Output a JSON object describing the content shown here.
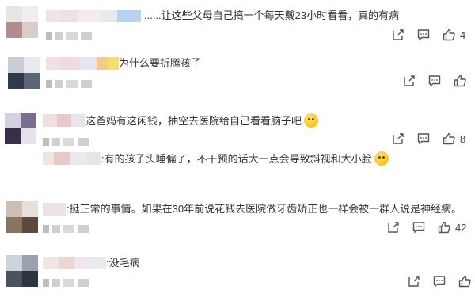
{
  "comments": [
    {
      "text": "......让这些父母自己搞一个每天戴23小时看看，真的有病",
      "like_count": "4",
      "icons": [
        "share-icon",
        "comment-icon",
        "like-icon"
      ]
    },
    {
      "text": "为什么要折腾孩子",
      "like_count": "",
      "icons": [
        "share-icon",
        "comment-icon",
        "like-icon"
      ]
    },
    {
      "text": "这爸妈有这闲钱，抽空去医院给自己看看脑子吧",
      "like_count": "8",
      "icons": [
        "share-icon",
        "comment-icon",
        "like-icon"
      ],
      "reply": {
        "text": ":有的孩子头睡偏了，不干预的话大一点会导致斜视和大小脸"
      }
    },
    {
      "text": ":挺正常的事情。如果在30年前说花钱去医院做牙齿矫正也一样会被一群人说是神经病。",
      "like_count": "42",
      "icons": [
        "share-icon",
        "comment-icon",
        "like-icon"
      ]
    },
    {
      "text": ":没毛病",
      "like_count": "",
      "icons": [
        "share-icon",
        "comment-icon",
        "like-icon"
      ]
    }
  ]
}
